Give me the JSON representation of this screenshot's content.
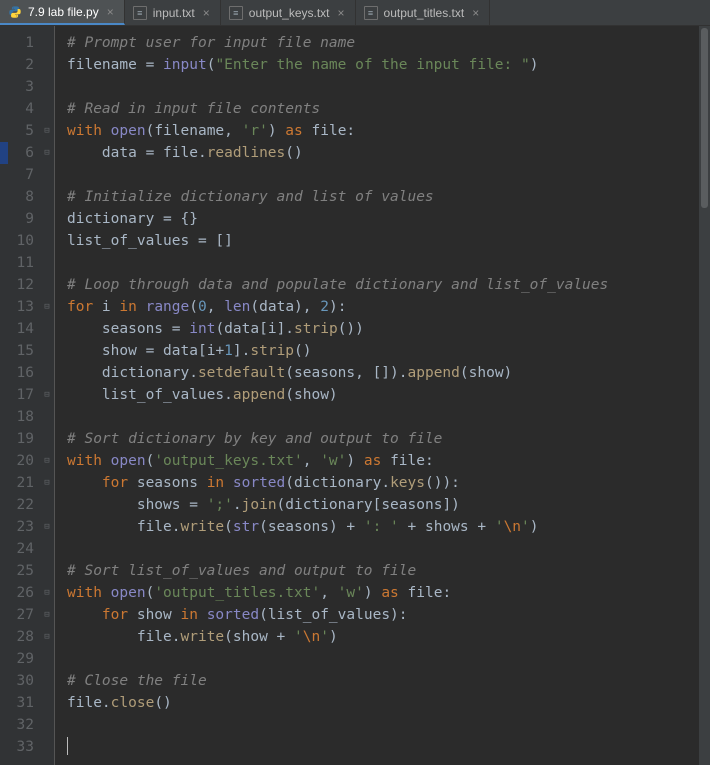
{
  "tabs": [
    {
      "label": "7.9 lab file.py",
      "icon": "python"
    },
    {
      "label": "input.txt",
      "icon": "text"
    },
    {
      "label": "output_keys.txt",
      "icon": "text"
    },
    {
      "label": "output_titles.txt",
      "icon": "text"
    }
  ],
  "active_tab_index": 0,
  "line_count": 33,
  "highlight_line": 6,
  "fold_marks": {
    "5": "open",
    "6": "close",
    "13": "open",
    "17": "close",
    "20": "open",
    "21": "open",
    "23": "close",
    "26": "open",
    "27": "open",
    "28": "close"
  },
  "code_lines": [
    [
      [
        "cmt",
        "# Prompt user for input file name"
      ]
    ],
    [
      [
        "id",
        "filename "
      ],
      [
        "op",
        "= "
      ],
      [
        "fn",
        "input"
      ],
      [
        "op",
        "("
      ],
      [
        "str",
        "\"Enter the name of the input file: \""
      ],
      [
        "op",
        ")"
      ]
    ],
    [],
    [
      [
        "cmt",
        "# Read in input file contents"
      ]
    ],
    [
      [
        "kw",
        "with "
      ],
      [
        "fn",
        "open"
      ],
      [
        "op",
        "("
      ],
      [
        "id",
        "filename"
      ],
      [
        "op",
        ", "
      ],
      [
        "str",
        "'r'"
      ],
      [
        "op",
        ") "
      ],
      [
        "kw",
        "as "
      ],
      [
        "id",
        "file"
      ],
      [
        "op",
        ":"
      ]
    ],
    [
      [
        "id",
        "    data "
      ],
      [
        "op",
        "= "
      ],
      [
        "id",
        "file"
      ],
      [
        "op",
        "."
      ],
      [
        "fn2",
        "readlines"
      ],
      [
        "op",
        "()"
      ]
    ],
    [],
    [
      [
        "cmt",
        "# Initialize dictionary and list of values"
      ]
    ],
    [
      [
        "id",
        "dictionary "
      ],
      [
        "op",
        "= {}"
      ]
    ],
    [
      [
        "id",
        "list_of_values "
      ],
      [
        "op",
        "= []"
      ]
    ],
    [],
    [
      [
        "cmt",
        "# Loop through data and populate dictionary and list_of_values"
      ]
    ],
    [
      [
        "kw",
        "for "
      ],
      [
        "id",
        "i "
      ],
      [
        "kw",
        "in "
      ],
      [
        "fn",
        "range"
      ],
      [
        "op",
        "("
      ],
      [
        "num",
        "0"
      ],
      [
        "op",
        ", "
      ],
      [
        "fn",
        "len"
      ],
      [
        "op",
        "("
      ],
      [
        "id",
        "data"
      ],
      [
        "op",
        "), "
      ],
      [
        "num",
        "2"
      ],
      [
        "op",
        "):"
      ]
    ],
    [
      [
        "id",
        "    seasons "
      ],
      [
        "op",
        "= "
      ],
      [
        "fn",
        "int"
      ],
      [
        "op",
        "("
      ],
      [
        "id",
        "data"
      ],
      [
        "op",
        "["
      ],
      [
        "id",
        "i"
      ],
      [
        "op",
        "]."
      ],
      [
        "fn2",
        "strip"
      ],
      [
        "op",
        "())"
      ]
    ],
    [
      [
        "id",
        "    show "
      ],
      [
        "op",
        "= "
      ],
      [
        "id",
        "data"
      ],
      [
        "op",
        "["
      ],
      [
        "id",
        "i"
      ],
      [
        "op",
        "+"
      ],
      [
        "num",
        "1"
      ],
      [
        "op",
        "]."
      ],
      [
        "fn2",
        "strip"
      ],
      [
        "op",
        "()"
      ]
    ],
    [
      [
        "id",
        "    dictionary"
      ],
      [
        "op",
        "."
      ],
      [
        "fn2",
        "setdefault"
      ],
      [
        "op",
        "("
      ],
      [
        "id",
        "seasons"
      ],
      [
        "op",
        ", [])."
      ],
      [
        "fn2",
        "append"
      ],
      [
        "op",
        "("
      ],
      [
        "id",
        "show"
      ],
      [
        "op",
        ")"
      ]
    ],
    [
      [
        "id",
        "    list_of_values"
      ],
      [
        "op",
        "."
      ],
      [
        "fn2",
        "append"
      ],
      [
        "op",
        "("
      ],
      [
        "id",
        "show"
      ],
      [
        "op",
        ")"
      ]
    ],
    [],
    [
      [
        "cmt",
        "# Sort dictionary by key and output to file"
      ]
    ],
    [
      [
        "kw",
        "with "
      ],
      [
        "fn",
        "open"
      ],
      [
        "op",
        "("
      ],
      [
        "str",
        "'output_keys.txt'"
      ],
      [
        "op",
        ", "
      ],
      [
        "str",
        "'w'"
      ],
      [
        "op",
        ") "
      ],
      [
        "kw",
        "as "
      ],
      [
        "id",
        "file"
      ],
      [
        "op",
        ":"
      ]
    ],
    [
      [
        "id",
        "    "
      ],
      [
        "kw",
        "for "
      ],
      [
        "id",
        "seasons "
      ],
      [
        "kw",
        "in "
      ],
      [
        "fn",
        "sorted"
      ],
      [
        "op",
        "("
      ],
      [
        "id",
        "dictionary"
      ],
      [
        "op",
        "."
      ],
      [
        "fn2",
        "keys"
      ],
      [
        "op",
        "()):"
      ]
    ],
    [
      [
        "id",
        "        shows "
      ],
      [
        "op",
        "= "
      ],
      [
        "str",
        "';'"
      ],
      [
        "op",
        "."
      ],
      [
        "fn2",
        "join"
      ],
      [
        "op",
        "("
      ],
      [
        "id",
        "dictionary"
      ],
      [
        "op",
        "["
      ],
      [
        "id",
        "seasons"
      ],
      [
        "op",
        "])"
      ]
    ],
    [
      [
        "id",
        "        file"
      ],
      [
        "op",
        "."
      ],
      [
        "fn2",
        "write"
      ],
      [
        "op",
        "("
      ],
      [
        "fn",
        "str"
      ],
      [
        "op",
        "("
      ],
      [
        "id",
        "seasons"
      ],
      [
        "op",
        ") + "
      ],
      [
        "str",
        "': '"
      ],
      [
        "op",
        " + "
      ],
      [
        "id",
        "shows"
      ],
      [
        "op",
        " + "
      ],
      [
        "str",
        "'"
      ],
      [
        "esc",
        "\\n"
      ],
      [
        "str",
        "'"
      ],
      [
        "op",
        ")"
      ]
    ],
    [],
    [
      [
        "cmt",
        "# Sort list_of_values and output to file"
      ]
    ],
    [
      [
        "kw",
        "with "
      ],
      [
        "fn",
        "open"
      ],
      [
        "op",
        "("
      ],
      [
        "str",
        "'output_titles.txt'"
      ],
      [
        "op",
        ", "
      ],
      [
        "str",
        "'w'"
      ],
      [
        "op",
        ") "
      ],
      [
        "kw",
        "as "
      ],
      [
        "id",
        "file"
      ],
      [
        "op",
        ":"
      ]
    ],
    [
      [
        "id",
        "    "
      ],
      [
        "kw",
        "for "
      ],
      [
        "id",
        "show "
      ],
      [
        "kw",
        "in "
      ],
      [
        "fn",
        "sorted"
      ],
      [
        "op",
        "("
      ],
      [
        "id",
        "list_of_values"
      ],
      [
        "op",
        "):"
      ]
    ],
    [
      [
        "id",
        "        file"
      ],
      [
        "op",
        "."
      ],
      [
        "fn2",
        "write"
      ],
      [
        "op",
        "("
      ],
      [
        "id",
        "show"
      ],
      [
        "op",
        " + "
      ],
      [
        "str",
        "'"
      ],
      [
        "esc",
        "\\n"
      ],
      [
        "str",
        "'"
      ],
      [
        "op",
        ")"
      ]
    ],
    [],
    [
      [
        "cmt",
        "# Close the file"
      ]
    ],
    [
      [
        "id",
        "file"
      ],
      [
        "op",
        "."
      ],
      [
        "fn2",
        "close"
      ],
      [
        "op",
        "()"
      ]
    ],
    [],
    []
  ],
  "caret_line": 33
}
